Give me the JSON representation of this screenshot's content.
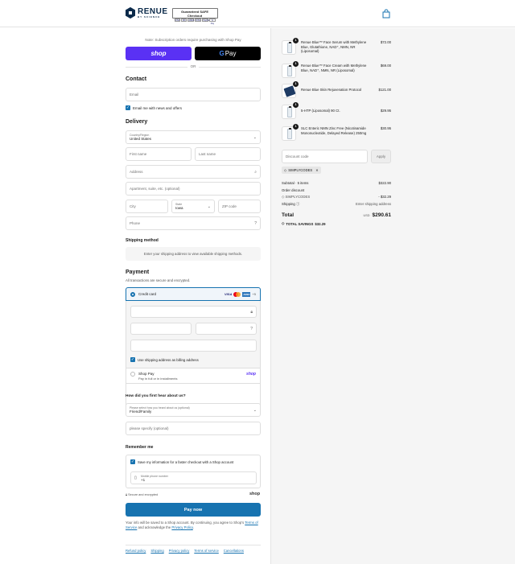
{
  "header": {
    "logo_text": "RENUE",
    "logo_sub": "BY SCIENCE",
    "badge_title": "Guaranteed SAFE Checkout",
    "badge_cards": [
      "VISA",
      "MC",
      "AMEX",
      "DISC",
      "PayPal",
      "G Pay"
    ]
  },
  "express": {
    "note": "Note: Subscription orders require purchasing with Shop Pay",
    "shop_pay_label": "shop",
    "gpay_label": "Pay",
    "gpay_g": "G",
    "or_label": "OR"
  },
  "contact": {
    "heading": "Contact",
    "email_placeholder": "Email",
    "newsletter_label": "Email me with news and offers"
  },
  "delivery": {
    "heading": "Delivery",
    "country_label": "Country/Region",
    "country_value": "United States",
    "first_name_placeholder": "First name",
    "last_name_placeholder": "Last name",
    "address_placeholder": "Address",
    "apartment_placeholder": "Apartment, suite, etc. (optional)",
    "city_placeholder": "City",
    "state_label": "State",
    "state_value": "Iowa",
    "zip_placeholder": "ZIP code",
    "phone_placeholder": "Phone"
  },
  "shipping": {
    "heading": "Shipping method",
    "message": "Enter your shipping address to view available shipping methods."
  },
  "payment": {
    "heading": "Payment",
    "subtitle": "All transactions are secure and encrypted.",
    "credit_card_label": "Credit card",
    "card_more": "+5",
    "billing_same_label": "Use shipping address as billing address",
    "shop_pay_label": "Shop Pay",
    "shop_pay_sub": "Pay in full or in installments",
    "shop_pay_logo": "shop"
  },
  "survey": {
    "heading": "How did you first hear about us?",
    "select_label": "Please select how you heard about us (optional)",
    "select_value": "Friend/Family",
    "specify_placeholder": "please specify (optional)"
  },
  "remember": {
    "heading": "Remember me",
    "save_label": "Save my information for a faster checkout with a Shop account",
    "mobile_label": "Mobile phone number",
    "mobile_value": "+1",
    "secure_label": "Secure and encrypted",
    "shop_logo": "shop"
  },
  "pay_now_label": "Pay now",
  "legal": {
    "text": "Your info will be saved to a Shop account. By continuing, you agree to Shop's",
    "terms": "Terms of Service",
    "and": " and acknowledge the ",
    "privacy": "Privacy Policy",
    "end": "."
  },
  "footer_links": [
    "Refund policy",
    "Shipping",
    "Privacy policy",
    "Terms of service",
    "Cancellations"
  ],
  "cart": {
    "items": [
      {
        "qty": "1",
        "name": "Renue Blue™ Face Serum with Methylene Blue, Glutathione, NAD⁺, NMN, NR (Liposomal)",
        "price": "$72.00",
        "kind": "bottle"
      },
      {
        "qty": "1",
        "name": "Renue Blue™ Face Cream with Methylene Blue, NAD⁺, NMN, NR (Liposomal)",
        "price": "$69.00",
        "kind": "bottle"
      },
      {
        "qty": "1",
        "name": "Renue Blue Skin Rejuvenation Protocol",
        "price": "$121.00",
        "kind": "box"
      },
      {
        "qty": "1",
        "name": "5-HTP (Liposomal) 90 Ct.",
        "price": "$29.95",
        "kind": "bottle"
      },
      {
        "qty": "1",
        "name": "SLC Enteric NMN Zinc Free (Nicotinamide Mononucleotide, Delayed Release) 250mg",
        "price": "$30.95",
        "kind": "bottle"
      }
    ],
    "discount_placeholder": "Discount code",
    "apply_label": "Apply",
    "applied_code": "SIMPLYCODES",
    "subtotal_label": "Subtotal · 5 items",
    "subtotal_value": "$322.90",
    "order_discount_label": "Order discount",
    "discount_code_label": "SIMPLYCODES",
    "discount_value": "- $32.29",
    "shipping_label": "Shipping",
    "shipping_value": "Enter shipping address",
    "total_label": "Total",
    "currency": "USD",
    "total_value": "$290.61",
    "savings_label": "TOTAL SAVINGS",
    "savings_value": "$32.29"
  }
}
